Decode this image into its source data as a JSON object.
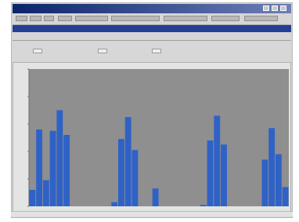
{
  "window": {
    "title": "",
    "colors": {
      "titlebar": "#0a246a",
      "plot_bg": "#8f8f8f",
      "bar": "#2f62c7"
    }
  },
  "toolbar": {
    "icons": [
      "file-icon",
      "save-icon",
      "print-icon",
      "chart-icon",
      "settings-icon"
    ]
  },
  "panel": {
    "left_label": "",
    "right_label": ""
  },
  "filters": {
    "item1": "",
    "item2": "",
    "item3": ""
  },
  "chart_data": {
    "type": "bar",
    "title": "",
    "xlabel": "",
    "ylabel": "",
    "ylim": [
      0,
      100
    ],
    "series": [
      {
        "values": [
          12,
          56,
          19,
          55,
          70,
          52,
          0,
          0,
          0,
          0,
          0,
          0,
          3,
          49,
          65,
          41,
          0,
          0,
          13,
          0,
          0,
          0,
          0,
          0,
          0,
          1,
          48,
          66,
          45,
          0,
          0,
          0,
          0,
          0,
          34,
          57,
          38,
          14
        ]
      }
    ]
  }
}
